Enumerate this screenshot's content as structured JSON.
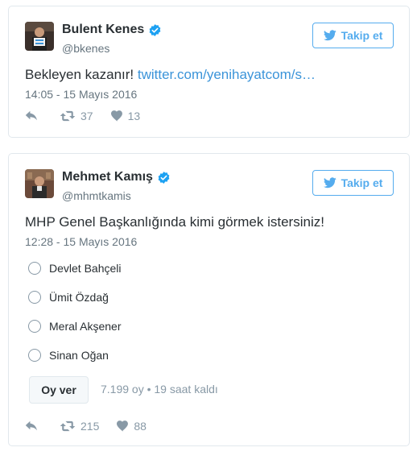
{
  "tweets": [
    {
      "author": {
        "name": "Bulent Kenes",
        "handle": "@bkenes"
      },
      "follow_label": "Takip et",
      "text": "Bekleyen kazanır!",
      "link": "twitter.com/yenihayatcom/s…",
      "timestamp": "14:05 - 15 Mayıs 2016",
      "retweets": "37",
      "likes": "13"
    },
    {
      "author": {
        "name": "Mehmet Kamış",
        "handle": "@mhmtkamis"
      },
      "follow_label": "Takip et",
      "text": "MHP Genel Başkanlığında kimi görmek istersiniz!",
      "timestamp": "12:28 - 15 Mayıs 2016",
      "poll": {
        "options": [
          "Devlet Bahçeli",
          "Ümit Özdağ",
          "Meral Akşener",
          "Sinan Oğan"
        ],
        "vote_label": "Oy ver",
        "meta": "7.199 oy • 19 saat kaldı"
      },
      "retweets": "215",
      "likes": "88"
    }
  ],
  "colors": {
    "link": "#3b94d9",
    "follow_accent": "#55acee",
    "verified": "#1da1f2",
    "muted_text": "#66757f",
    "action_gray": "#8899a6",
    "border": "#e1e8ed"
  },
  "icons": {
    "verified": "verified-badge-icon",
    "follow_bird": "twitter-bird-icon",
    "reply": "reply-icon",
    "retweet": "retweet-icon",
    "like": "heart-icon",
    "radio": "radio-button-icon"
  }
}
